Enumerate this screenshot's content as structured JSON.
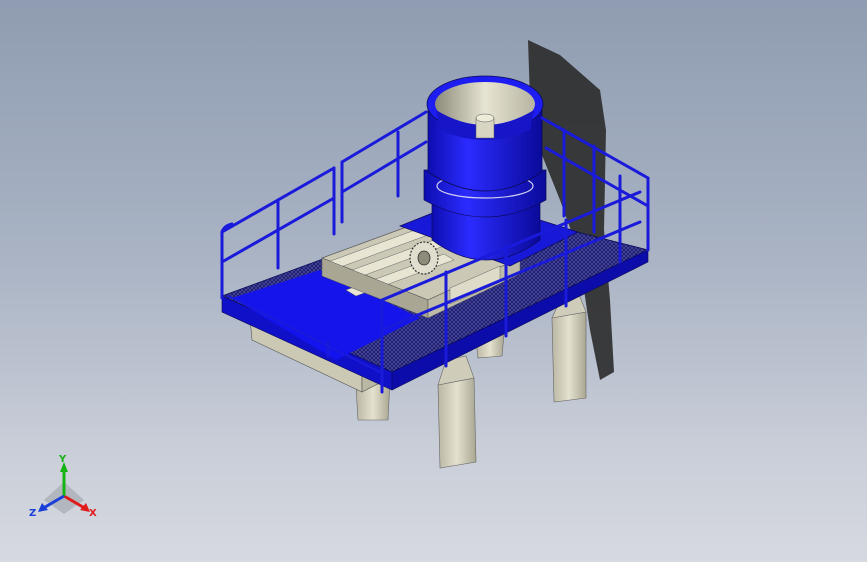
{
  "viewport": {
    "background_top": "#8f9cb1",
    "background_bottom": "#d6d9e0"
  },
  "model": {
    "railing_color": "#1a1adb",
    "deck_color": "#1414f0",
    "frame_color": "#d9d6c2",
    "crusher_color": "#1d1df2"
  },
  "triad": {
    "x_label": "X",
    "y_label": "Y",
    "z_label": "Z",
    "x_color": "#e01b1b",
    "y_color": "#16b316",
    "z_color": "#1a3fd8"
  }
}
